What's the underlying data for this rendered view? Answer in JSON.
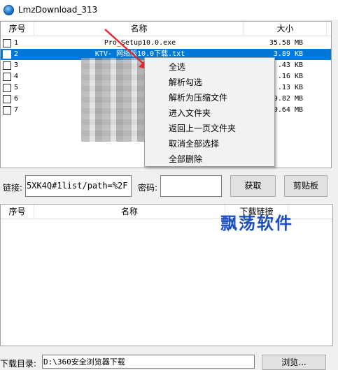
{
  "window": {
    "title": "LmzDownload_313"
  },
  "file_table": {
    "columns": [
      "序号",
      "名称",
      "大小"
    ],
    "rows": [
      {
        "index": "1",
        "name": "Pro_Setup10.0.exe",
        "size": "35.58 MB",
        "selected": false
      },
      {
        "index": "2",
        "name": "KTV-    网络版10.0下载.txt",
        "size": "3.89 KB",
        "selected": true
      },
      {
        "index": "3",
        "name": "",
        "size": ".43 KB",
        "selected": false
      },
      {
        "index": "4",
        "name": "",
        "size": ".16 KB",
        "selected": false
      },
      {
        "index": "5",
        "name": "",
        "size": ".13 KB",
        "selected": false
      },
      {
        "index": "6",
        "name": "",
        "size": "9.82 MB",
        "selected": false
      },
      {
        "index": "7",
        "name": "",
        "size": "0.64 MB",
        "selected": false
      }
    ]
  },
  "context_menu": {
    "items": [
      "全选",
      "解析勾选",
      "解析为压缩文件",
      "进入文件夹",
      "返回上一页文件夹",
      "取消全部选择",
      "全部删除"
    ]
  },
  "link_bar": {
    "link_label": "链接:",
    "link_value": "5XK4Q#1list/path=%2F",
    "password_label": "密码:",
    "password_value": "",
    "fetch_button": "获取",
    "clipboard_button": "剪贴板"
  },
  "download_table": {
    "columns": [
      "序号",
      "名称",
      "下载链接"
    ]
  },
  "watermark": "飘荡软件",
  "download_dir": {
    "label": "下载目录:",
    "value": "D:\\360安全浏览器下载",
    "browse_button": "浏览..."
  },
  "colors": {
    "selection": "#0078d7",
    "arrow": "#e8262b",
    "watermark": "#1e4fbf"
  }
}
